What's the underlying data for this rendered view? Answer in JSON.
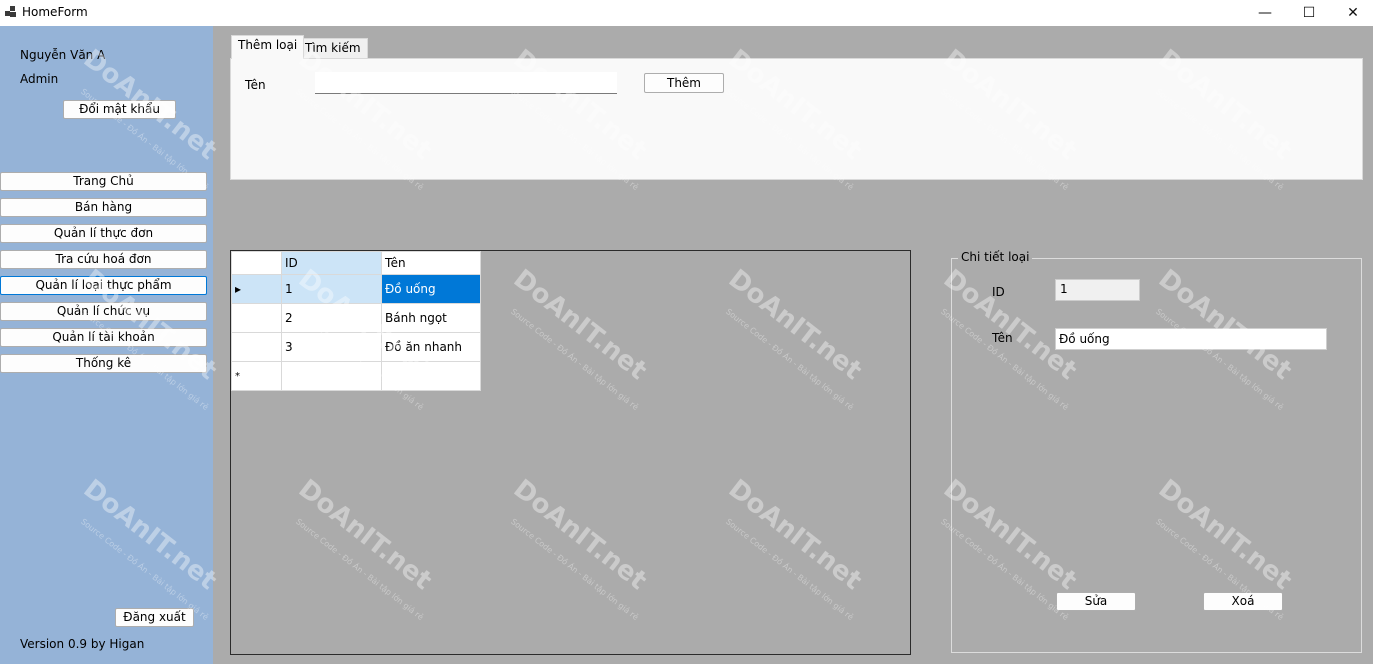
{
  "window": {
    "title": "HomeForm",
    "minimize_glyph": "—",
    "maximize_glyph": "☐",
    "close_glyph": "✕"
  },
  "sidebar": {
    "user_name": "Nguyễn Văn A",
    "user_role": "Admin",
    "change_password_label": "Đổi mật khẩu",
    "nav": [
      {
        "label": "Trang Chủ"
      },
      {
        "label": "Bán hàng"
      },
      {
        "label": "Quản lí thực đơn"
      },
      {
        "label": "Tra cứu hoá đơn"
      },
      {
        "label": "Quản lí loại thực phẩm",
        "active": true
      },
      {
        "label": "Quản lí chức vụ"
      },
      {
        "label": "Quản lí tài khoản"
      },
      {
        "label": "Thống kê"
      }
    ],
    "logout_label": "Đăng xuất",
    "version": "Version 0.9 by Higan"
  },
  "tabs": [
    {
      "label": "Thêm loại",
      "active": true
    },
    {
      "label": "Tìm kiếm"
    }
  ],
  "add_panel": {
    "name_label": "Tên",
    "name_value": "",
    "add_button": "Thêm"
  },
  "grid": {
    "columns": [
      "ID",
      "Tên"
    ],
    "rows": [
      {
        "id": "1",
        "name": "Đồ uống",
        "selected": true
      },
      {
        "id": "2",
        "name": "Bánh ngọt"
      },
      {
        "id": "3",
        "name": "Đồ ăn nhanh"
      }
    ],
    "current_row_marker": "▸",
    "new_row_marker": "*"
  },
  "detail": {
    "title": "Chi tiết loại",
    "id_label": "ID",
    "id_value": "1",
    "name_label": "Tên",
    "name_value": "Đồ uống",
    "edit_button": "Sửa",
    "delete_button": "Xoá"
  },
  "watermark": {
    "brand": "DoAnIT.net",
    "tagline": "Source Code - Đồ Án - Bài tập lớn giá rẻ"
  }
}
